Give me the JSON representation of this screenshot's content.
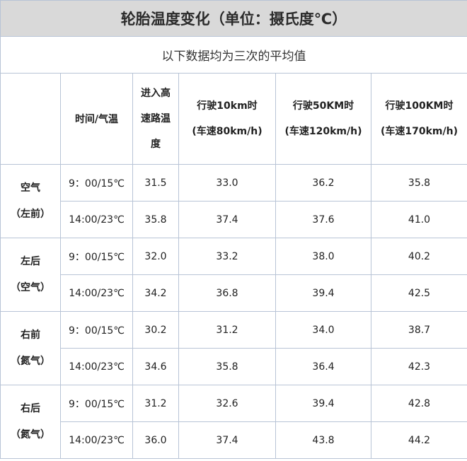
{
  "title": "轮胎温度变化（单位：摄氏度℃）",
  "subtitle": "以下数据均为三次的平均值",
  "headers": {
    "time_temp": "时间/气温",
    "highway_entry": [
      "进入高",
      "速路温",
      "度"
    ],
    "speed_10km": [
      "行驶10km时",
      "(车速80km/h)"
    ],
    "speed_50km": [
      "行驶50KM时",
      "(车速120km/h)"
    ],
    "speed_100km": [
      "行驶100KM时",
      "(车速170km/h)"
    ]
  },
  "groups": [
    {
      "label_line1": "空气",
      "label_line2": "（左前）",
      "color": "#222222",
      "rows": [
        {
          "time": "9：00/15℃",
          "entry": "31.5",
          "d10": "33.0",
          "d50": "36.2",
          "d100": "35.8"
        },
        {
          "time": "14:00/23℃",
          "entry": "35.8",
          "d10": "37.4",
          "d50": "37.6",
          "d100": "41.0"
        }
      ]
    },
    {
      "label_line1": "左后",
      "label_line2": "（空气）",
      "color": "#222222",
      "rows": [
        {
          "time": "9：00/15℃",
          "entry": "32.0",
          "d10": "33.2",
          "d50": "38.0",
          "d100": "40.2"
        },
        {
          "time": "14:00/23℃",
          "entry": "34.2",
          "d10": "36.8",
          "d50": "39.4",
          "d100": "42.5"
        }
      ]
    },
    {
      "label_line1": "右前",
      "label_line2": "（氮气）",
      "color": "#1f3fa6",
      "rows": [
        {
          "time": "9：00/15℃",
          "entry": "30.2",
          "d10": "31.2",
          "d50": "34.0",
          "d100": "38.7"
        },
        {
          "time": "14:00/23℃",
          "entry": "34.6",
          "d10": "35.8",
          "d50": "36.4",
          "d100": "42.3"
        }
      ]
    },
    {
      "label_line1": "右后",
      "label_line2": "（氮气）",
      "color": "#1f3fa6",
      "rows": [
        {
          "time": "9：00/15℃",
          "entry": "31.2",
          "d10": "32.6",
          "d50": "39.4",
          "d100": "42.8"
        },
        {
          "time": "14:00/23℃",
          "entry": "36.0",
          "d10": "37.4",
          "d50": "43.8",
          "d100": "44.2"
        }
      ]
    }
  ],
  "colors": {
    "title_bg": "#d9d9d9",
    "border": "#b8c4d6",
    "nitrogen_label": "#1f3fa6"
  }
}
